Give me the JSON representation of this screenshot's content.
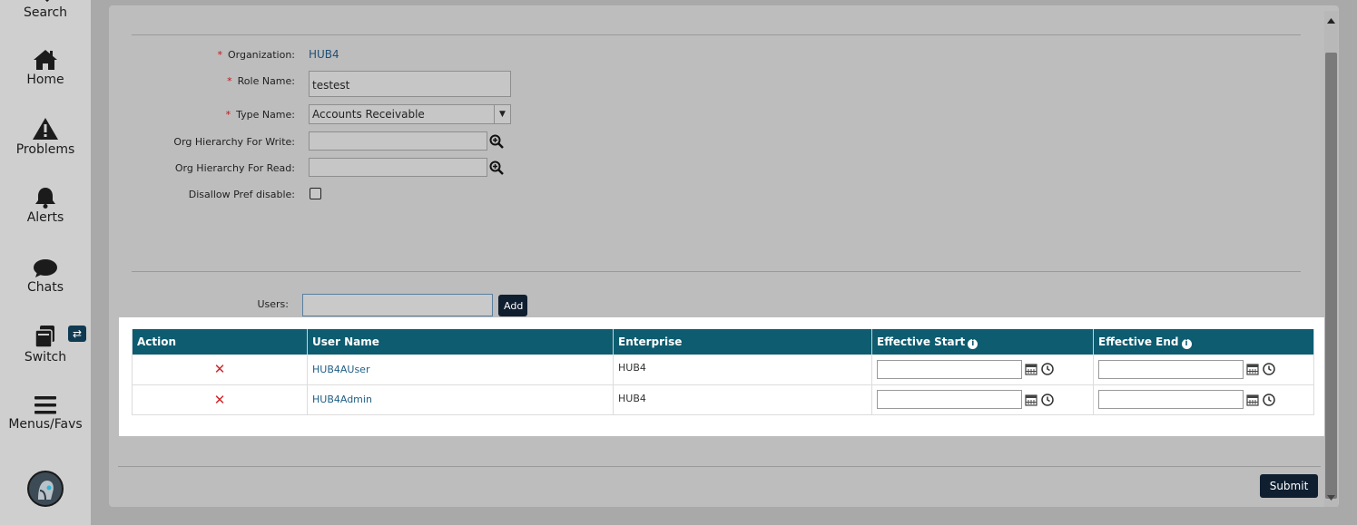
{
  "sidebar": {
    "items": [
      {
        "label": "Search",
        "icon": "search-icon"
      },
      {
        "label": "Home",
        "icon": "home-icon"
      },
      {
        "label": "Problems",
        "icon": "warning-icon"
      },
      {
        "label": "Alerts",
        "icon": "bell-icon"
      },
      {
        "label": "Chats",
        "icon": "chat-icon"
      },
      {
        "label": "Switch",
        "icon": "switch-icon"
      },
      {
        "label": "Menus/Favs",
        "icon": "menu-icon"
      }
    ],
    "switch_badge": "⇄"
  },
  "form": {
    "required_mark": "*",
    "organization_label": "Organization:",
    "organization_value": "HUB4",
    "role_name_label": "Role Name:",
    "role_name_value": "testest",
    "type_name_label": "Type Name:",
    "type_name_value": "Accounts Receivable",
    "org_write_label": "Org Hierarchy For Write:",
    "org_write_value": "",
    "org_read_label": "Org Hierarchy For Read:",
    "org_read_value": "",
    "disallow_label": "Disallow Pref disable:",
    "disallow_checked": false
  },
  "users_section": {
    "label": "Users:",
    "input_value": "",
    "add_button": "Add"
  },
  "table": {
    "columns": [
      "Action",
      "User Name",
      "Enterprise",
      "Effective Start",
      "Effective End"
    ],
    "rows": [
      {
        "action": "✕",
        "user_name": "HUB4AUser",
        "enterprise": "HUB4",
        "effective_start": "",
        "effective_end": ""
      },
      {
        "action": "✕",
        "user_name": "HUB4Admin",
        "enterprise": "HUB4",
        "effective_start": "",
        "effective_end": ""
      }
    ]
  },
  "footer": {
    "submit_button": "Submit"
  },
  "colors": {
    "header_teal": "#0d5c70",
    "button_dark": "#0f1f30",
    "required_red": "#c0161f",
    "link_blue": "#1f5f85"
  }
}
